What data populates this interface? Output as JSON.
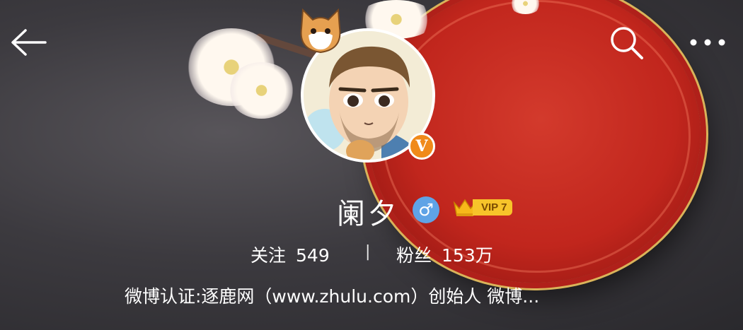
{
  "header": {
    "back_icon": "arrow-left-icon",
    "search_icon": "search-icon",
    "more_icon": "more-dots-icon"
  },
  "profile": {
    "name": "阑夕",
    "gender_symbol": "♂",
    "verified_badge": "V",
    "vip_label": "VIP 7",
    "following_label": "关注",
    "following_count": "549",
    "divider": "|",
    "followers_label": "粉丝",
    "followers_count": "153万",
    "bio": "微博认证:逐鹿网（www.zhulu.com）创始人 微博..."
  },
  "colors": {
    "bowl": "#c1261d",
    "gender_badge": "#5fa3e6",
    "verified_badge": "#f08a1a",
    "vip_badge": "#f7c42a"
  }
}
